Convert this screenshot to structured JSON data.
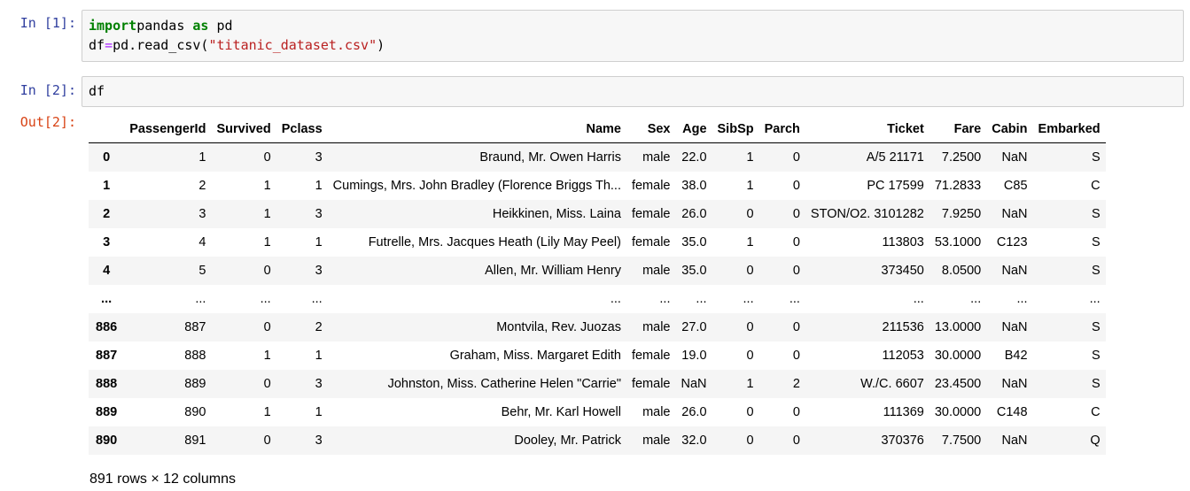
{
  "cells": [
    {
      "prompt": "In [1]:",
      "code_lines": [
        [
          [
            "kw",
            "import"
          ],
          [
            "",
            "pandas "
          ],
          [
            "kw",
            "as"
          ],
          [
            "",
            " pd"
          ]
        ],
        [
          [
            "",
            "df"
          ],
          [
            "op",
            "="
          ],
          [
            "",
            "pd.read_csv("
          ],
          [
            "str",
            "\"titanic_dataset.csv\""
          ],
          [
            "",
            ")"
          ]
        ]
      ]
    },
    {
      "prompt": "In [2]:",
      "code_lines": [
        [
          [
            "",
            "df"
          ]
        ]
      ]
    }
  ],
  "output_prompt": "Out[2]:",
  "table": {
    "columns": [
      "",
      "PassengerId",
      "Survived",
      "Pclass",
      "Name",
      "Sex",
      "Age",
      "SibSp",
      "Parch",
      "Ticket",
      "Fare",
      "Cabin",
      "Embarked"
    ],
    "rows": [
      [
        "0",
        "1",
        "0",
        "3",
        "Braund, Mr. Owen Harris",
        "male",
        "22.0",
        "1",
        "0",
        "A/5 21171",
        "7.2500",
        "NaN",
        "S"
      ],
      [
        "1",
        "2",
        "1",
        "1",
        "Cumings, Mrs. John Bradley (Florence Briggs Th...",
        "female",
        "38.0",
        "1",
        "0",
        "PC 17599",
        "71.2833",
        "C85",
        "C"
      ],
      [
        "2",
        "3",
        "1",
        "3",
        "Heikkinen, Miss. Laina",
        "female",
        "26.0",
        "0",
        "0",
        "STON/O2. 3101282",
        "7.9250",
        "NaN",
        "S"
      ],
      [
        "3",
        "4",
        "1",
        "1",
        "Futrelle, Mrs. Jacques Heath (Lily May Peel)",
        "female",
        "35.0",
        "1",
        "0",
        "113803",
        "53.1000",
        "C123",
        "S"
      ],
      [
        "4",
        "5",
        "0",
        "3",
        "Allen, Mr. William Henry",
        "male",
        "35.0",
        "0",
        "0",
        "373450",
        "8.0500",
        "NaN",
        "S"
      ],
      [
        "...",
        "...",
        "...",
        "...",
        "...",
        "...",
        "...",
        "...",
        "...",
        "...",
        "...",
        "...",
        "..."
      ],
      [
        "886",
        "887",
        "0",
        "2",
        "Montvila, Rev. Juozas",
        "male",
        "27.0",
        "0",
        "0",
        "211536",
        "13.0000",
        "NaN",
        "S"
      ],
      [
        "887",
        "888",
        "1",
        "1",
        "Graham, Miss. Margaret Edith",
        "female",
        "19.0",
        "0",
        "0",
        "112053",
        "30.0000",
        "B42",
        "S"
      ],
      [
        "888",
        "889",
        "0",
        "3",
        "Johnston, Miss. Catherine Helen \"Carrie\"",
        "female",
        "NaN",
        "1",
        "2",
        "W./C. 6607",
        "23.4500",
        "NaN",
        "S"
      ],
      [
        "889",
        "890",
        "1",
        "1",
        "Behr, Mr. Karl Howell",
        "male",
        "26.0",
        "0",
        "0",
        "111369",
        "30.0000",
        "C148",
        "C"
      ],
      [
        "890",
        "891",
        "0",
        "3",
        "Dooley, Mr. Patrick",
        "male",
        "32.0",
        "0",
        "0",
        "370376",
        "7.7500",
        "NaN",
        "Q"
      ]
    ]
  },
  "footer": "891 rows × 12 columns"
}
